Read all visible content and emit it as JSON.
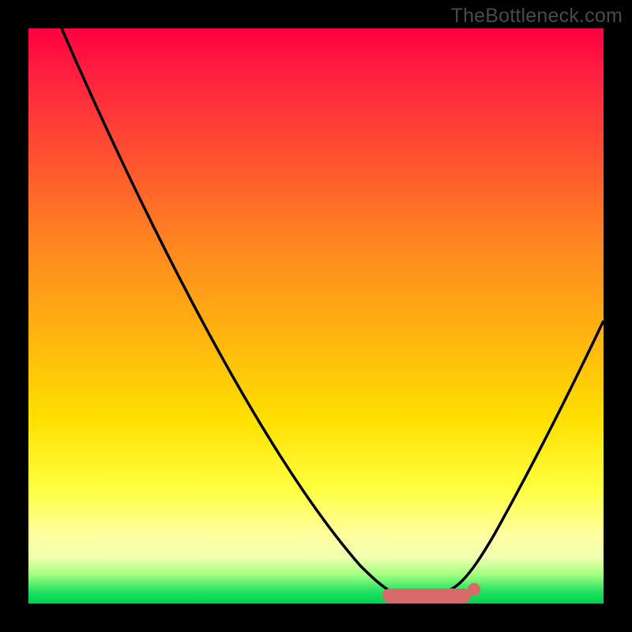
{
  "watermark": "TheBottleneck.com",
  "colors": {
    "background": "#000000",
    "gradient_top": "#ff0040",
    "gradient_bottom": "#00d050",
    "curve": "#000000",
    "marker": "#d96a6a"
  },
  "chart_data": {
    "type": "line",
    "title": "",
    "xlabel": "",
    "ylabel": "",
    "xlim": [
      0,
      100
    ],
    "ylim": [
      0,
      100
    ],
    "grid": false,
    "legend": false,
    "annotations": [
      "optimal-range-marker"
    ],
    "series": [
      {
        "name": "bottleneck-curve",
        "x": [
          0,
          10,
          20,
          30,
          40,
          50,
          58,
          62,
          66,
          70,
          75,
          80,
          85,
          90,
          95,
          100
        ],
        "values": [
          100,
          86,
          72,
          57,
          42,
          26,
          12,
          4,
          0,
          0,
          0,
          4,
          14,
          27,
          41,
          55
        ]
      }
    ],
    "optimal_range": {
      "x_start": 62,
      "x_end": 77
    }
  }
}
